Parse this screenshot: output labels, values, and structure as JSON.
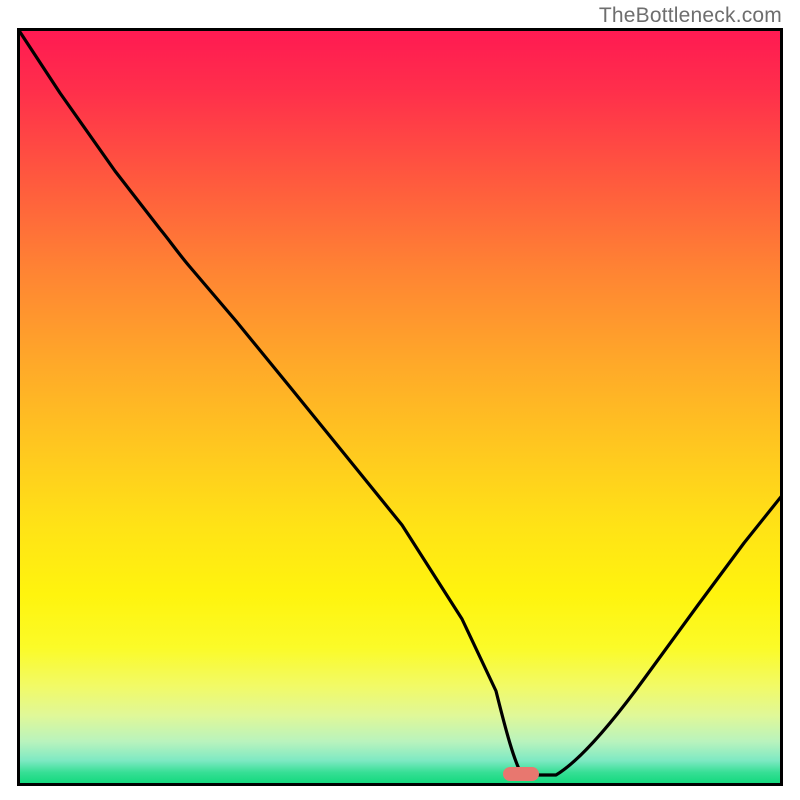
{
  "watermark": "TheBottleneck.com",
  "marker": {
    "x_pct": 65.5,
    "y_pct": 99.0,
    "color": "#e8776f"
  },
  "chart_data": {
    "type": "line",
    "title": "",
    "xlabel": "",
    "ylabel": "",
    "xlim": [
      0,
      100
    ],
    "ylim": [
      0,
      100
    ],
    "grid": false,
    "legend": false,
    "background_gradient": {
      "orientation": "vertical",
      "stops": [
        {
          "pos": 0,
          "color": "#ff1a52"
        },
        {
          "pos": 20,
          "color": "#ff5a3e"
        },
        {
          "pos": 44,
          "color": "#ffa829"
        },
        {
          "pos": 66,
          "color": "#ffe316"
        },
        {
          "pos": 82,
          "color": "#fbfb28"
        },
        {
          "pos": 94.5,
          "color": "#b9f3bd"
        },
        {
          "pos": 100,
          "color": "#14d97e"
        }
      ]
    },
    "series": [
      {
        "name": "curve",
        "color": "#000000",
        "x": [
          0,
          5,
          12,
          18,
          22,
          28,
          35,
          42,
          50,
          58,
          62,
          66,
          70,
          76,
          82,
          88,
          94,
          100
        ],
        "y": [
          100,
          92,
          82,
          74,
          70,
          62,
          53,
          44,
          34,
          22,
          12,
          3,
          1,
          1,
          10,
          22,
          34,
          45
        ]
      }
    ],
    "optimum_marker": {
      "x": 67,
      "y": 1
    }
  }
}
